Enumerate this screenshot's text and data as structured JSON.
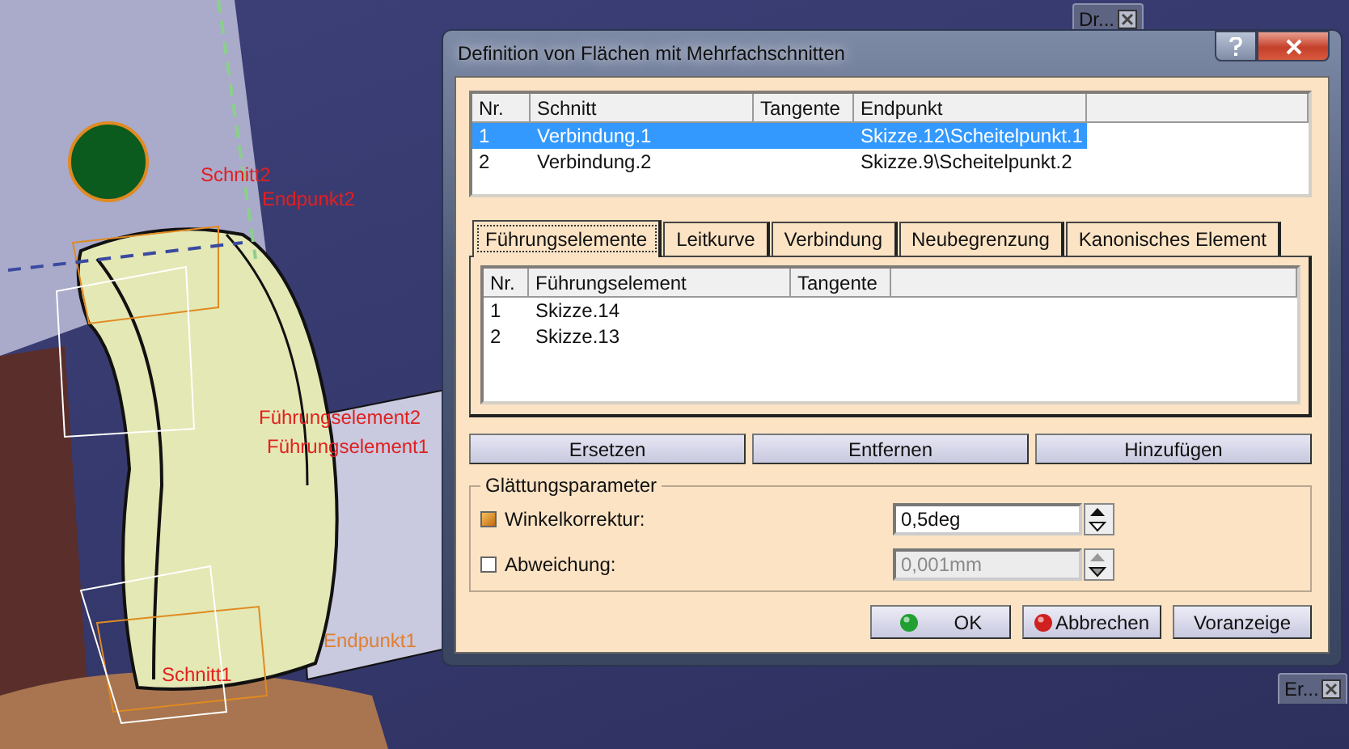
{
  "viewport": {
    "labels": [
      {
        "text": "Schnitt2",
        "kind": "red"
      },
      {
        "text": "Endpunkt2",
        "kind": "red"
      },
      {
        "text": "Führungselement2",
        "kind": "red"
      },
      {
        "text": "Führungselement1",
        "kind": "red"
      },
      {
        "text": "Endpunkt1",
        "kind": "orange"
      },
      {
        "text": "Schnitt1",
        "kind": "red"
      }
    ]
  },
  "mini_windows": [
    {
      "title": "Dr..."
    },
    {
      "title": "Er..."
    }
  ],
  "dialog": {
    "title": "Definition von Flächen mit Mehrfachschnitten",
    "sections_table": {
      "columns": [
        "Nr.",
        "Schnitt",
        "Tangente",
        "Endpunkt"
      ],
      "rows": [
        {
          "nr": "1",
          "schnitt": "Verbindung.1",
          "endpunkt": "Skizze.12\\Scheitelpunkt.1",
          "selected": true
        },
        {
          "nr": "2",
          "schnitt": "Verbindung.2",
          "endpunkt": "Skizze.9\\Scheitelpunkt.2",
          "selected": false
        }
      ]
    },
    "tabs": [
      {
        "label": "Führungselemente",
        "selected": true
      },
      {
        "label": "Leitkurve",
        "selected": false
      },
      {
        "label": "Verbindung",
        "selected": false
      },
      {
        "label": "Neubegrenzung",
        "selected": false
      },
      {
        "label": "Kanonisches Element",
        "selected": false
      }
    ],
    "guides_table": {
      "columns": [
        "Nr.",
        "Führungselement",
        "Tangente"
      ],
      "rows": [
        {
          "nr": "1",
          "element": "Skizze.14"
        },
        {
          "nr": "2",
          "element": "Skizze.13"
        }
      ]
    },
    "list_buttons": [
      "Ersetzen",
      "Entfernen",
      "Hinzufügen"
    ],
    "smoothing": {
      "title": "Glättungsparameter",
      "params": [
        {
          "label": "Winkelkorrektur:",
          "checked": true,
          "value": "0,5deg",
          "disabled": false
        },
        {
          "label": "Abweichung:",
          "checked": false,
          "value": "0,001mm",
          "disabled": true
        }
      ]
    },
    "footer_buttons": [
      {
        "label": "OK",
        "kind": "ok"
      },
      {
        "label": "Abbrechen",
        "kind": "cancel"
      },
      {
        "label": "Voranzeige",
        "kind": "plain"
      }
    ]
  }
}
